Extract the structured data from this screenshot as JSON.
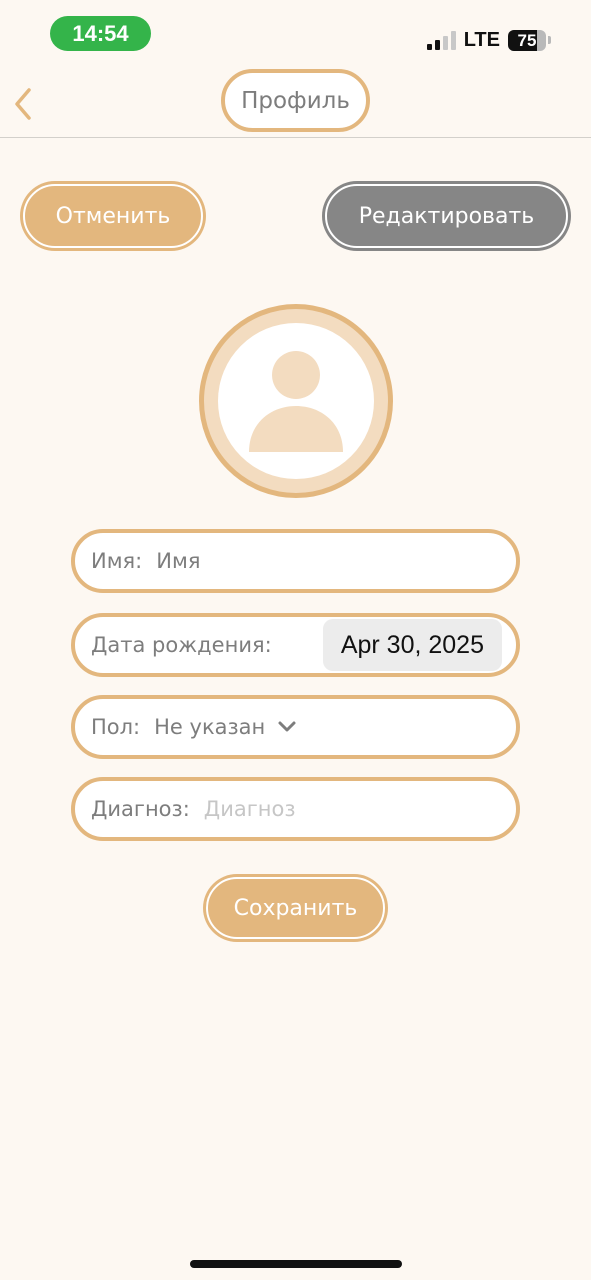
{
  "status_bar": {
    "time": "14:54",
    "network": "LTE",
    "battery": "75",
    "battery_level": 0.75
  },
  "header": {
    "title": "Профиль",
    "back_icon": "chevron-left-icon"
  },
  "actions": {
    "cancel_label": "Отменить",
    "edit_label": "Редактировать",
    "save_label": "Сохранить"
  },
  "avatar": {
    "icon": "user-placeholder-icon"
  },
  "form": {
    "name_label": "Имя:",
    "name_placeholder": "Имя",
    "birth_label": "Дата рождения:",
    "birth_value": "Apr 30, 2025",
    "gender_label": "Пол:",
    "gender_value": "Не указан",
    "diagnosis_label": "Диагноз:",
    "diagnosis_placeholder": "Диагноз"
  },
  "colors": {
    "accent": "#e3b77e",
    "accent_light": "#f3dcc0",
    "gray_button": "#868686",
    "text": "#7d7d7d",
    "background": "#fdf8f2",
    "status_green": "#34b44a"
  }
}
